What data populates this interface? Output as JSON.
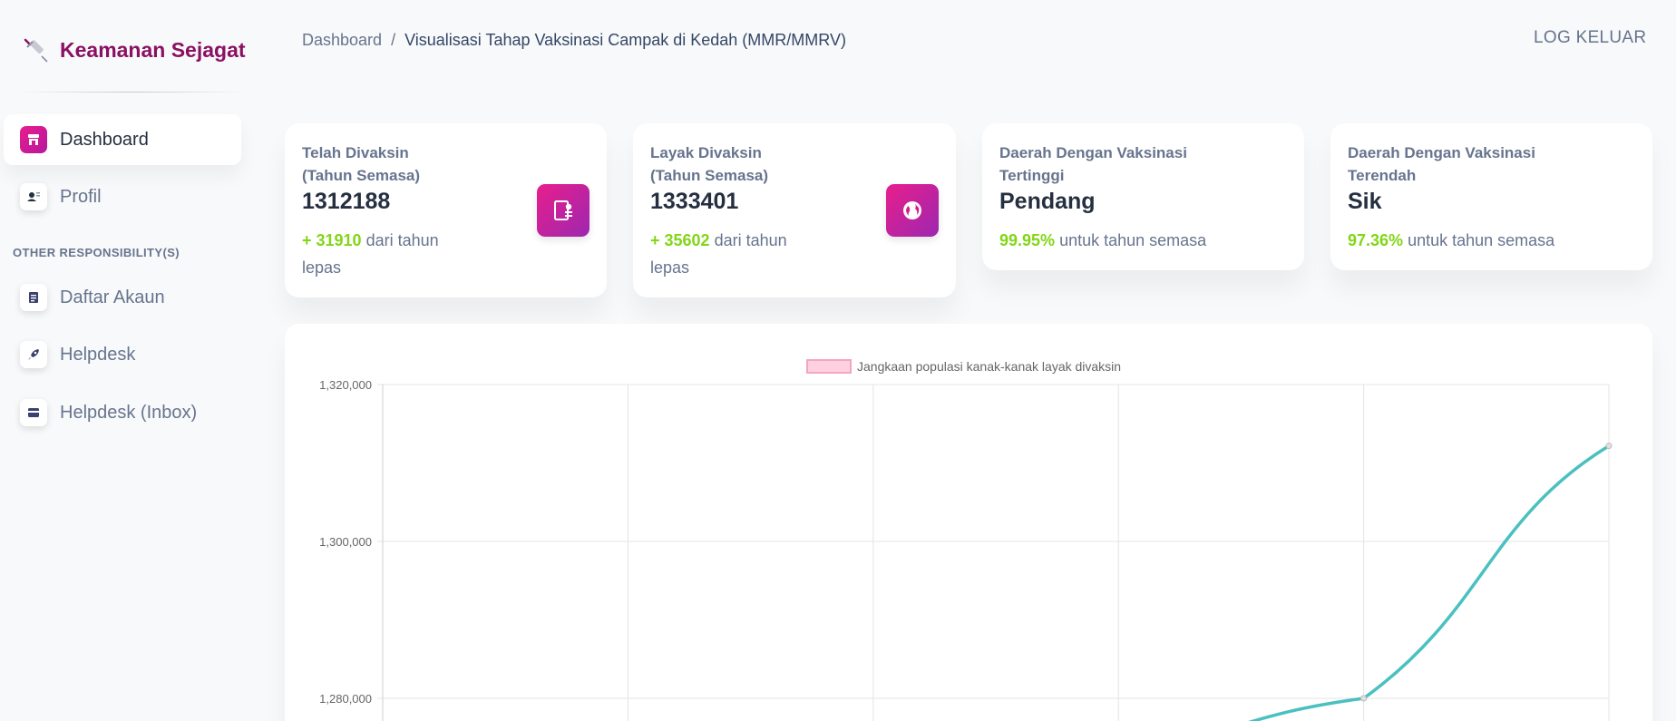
{
  "sidebar": {
    "brand": "Keamanan Sejagat",
    "items": [
      {
        "label": "Dashboard",
        "icon": "shop-icon"
      },
      {
        "label": "Profil",
        "icon": "user-icon"
      }
    ],
    "section_title": "OTHER RESPONSIBILITY(S)",
    "other_items": [
      {
        "label": "Daftar Akaun",
        "icon": "document-icon"
      },
      {
        "label": "Helpdesk",
        "icon": "rocket-icon"
      },
      {
        "label": "Helpdesk (Inbox)",
        "icon": "card-icon"
      }
    ]
  },
  "header": {
    "breadcrumb_root": "Dashboard",
    "breadcrumb_sep": "/",
    "breadcrumb_current": "Visualisasi Tahap Vaksinasi Campak di Kedah (MMR/MMRV)",
    "logout": "LOG KELUAR"
  },
  "cards": [
    {
      "label_line1": "Telah Divaksin",
      "label_line2": "(Tahun Semasa)",
      "value": "1312188",
      "delta": "+ 31910",
      "sub_line1": " dari tahun",
      "sub_line2": "lepas",
      "icon": "clipboard-icon"
    },
    {
      "label_line1": "Layak Divaksin",
      "label_line2": "(Tahun Semasa)",
      "value": "1333401",
      "delta": "+ 35602",
      "sub_line1": " dari tahun",
      "sub_line2": "lepas",
      "icon": "globe-icon"
    },
    {
      "label_line1": "Daerah Dengan Vaksinasi",
      "label_line2": "Tertinggi",
      "value": "Pendang",
      "delta": "99.95%",
      "sub_line1": " untuk tahun semasa"
    },
    {
      "label_line1": "Daerah Dengan Vaksinasi",
      "label_line2": "Terendah",
      "value": "Sik",
      "delta": "97.36%",
      "sub_line1": " untuk tahun semasa"
    }
  ],
  "colors": {
    "accent": "#8a1063",
    "positive": "#82d616",
    "line": "#4bc0c0",
    "legend_fill": "#ffd1e0",
    "legend_stroke": "#f4a6bf"
  },
  "chart_data": {
    "type": "line",
    "legend": "Jangkaan populasi kanak-kanak layak divaksin",
    "y_ticks": [
      "1,320,000",
      "1,300,000",
      "1,280,000"
    ],
    "ylim_visible": [
      1280000,
      1320000
    ],
    "series": [
      {
        "name": "Jangkaan populasi kanak-kanak layak divaksin",
        "x_index": [
          3,
          4,
          5
        ],
        "values": [
          1273000,
          1280000,
          1312188
        ]
      }
    ],
    "grid": true
  }
}
